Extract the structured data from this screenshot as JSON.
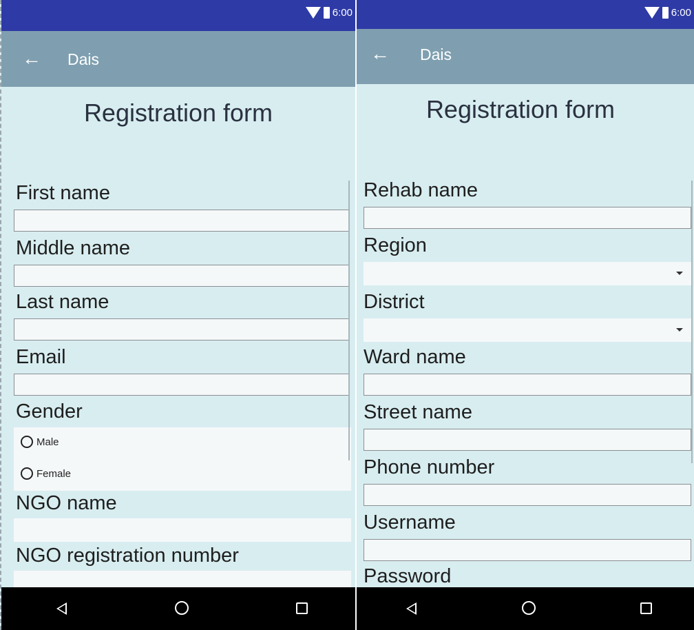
{
  "status": {
    "time": "6:00"
  },
  "appbar": {
    "title": "Dais",
    "back_icon": "arrow-left-icon"
  },
  "screen1": {
    "form_title": "Registration form",
    "fields": {
      "first_name": "First name",
      "middle_name": "Middle name",
      "last_name": "Last name",
      "email": "Email",
      "gender": "Gender",
      "ngo_name": "NGO name",
      "ngo_reg": "NGO registration number"
    },
    "gender_options": [
      "Male",
      "Female"
    ]
  },
  "screen2": {
    "form_title": "Registration form",
    "fields": {
      "rehab_name": "Rehab name",
      "region": "Region",
      "district": "District",
      "ward_name": "Ward name",
      "street_name": "Street name",
      "phone": "Phone number",
      "username": "Username",
      "password": "Password"
    }
  },
  "navbar": {
    "icons": [
      "back-triangle-icon",
      "home-circle-icon",
      "recent-square-icon"
    ]
  },
  "colors": {
    "status_bar": "#2e3aa6",
    "app_bar": "#7f9fb0",
    "background": "#d8edf0",
    "field": "#f5f8f9"
  }
}
